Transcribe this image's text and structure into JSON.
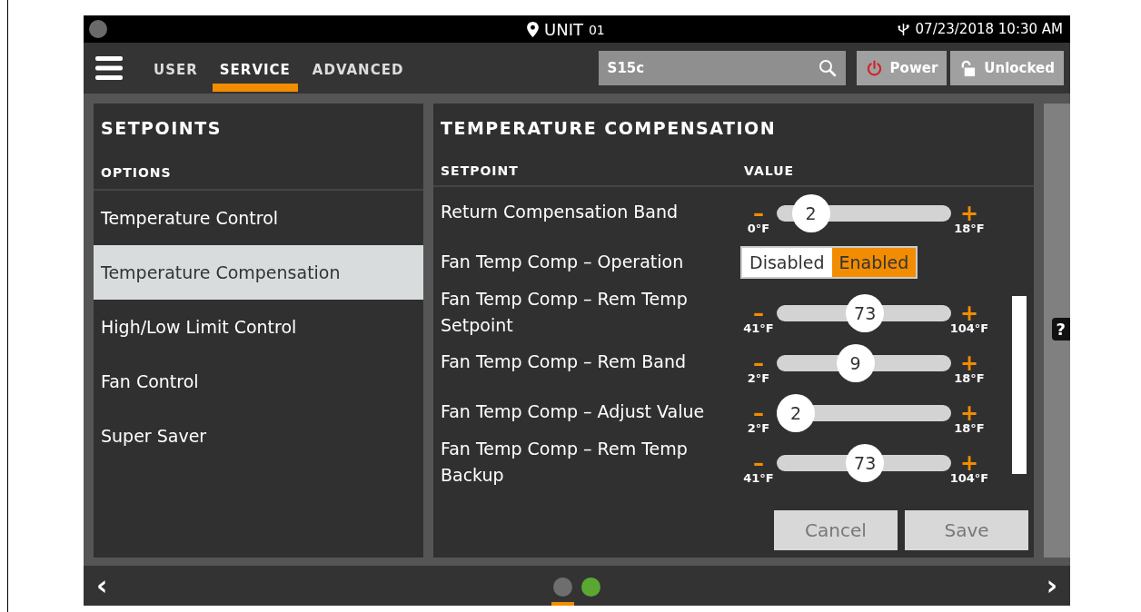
{
  "status_bar": {
    "location": "UNIT",
    "unit_number": "01",
    "datetime": "07/23/2018 10:30 AM"
  },
  "tabs": [
    {
      "label": "USER",
      "selected": false
    },
    {
      "label": "SERVICE",
      "selected": true
    },
    {
      "label": "ADVANCED",
      "selected": false
    }
  ],
  "search": {
    "value": "S15c"
  },
  "buttons": {
    "power": "Power",
    "lock": "Unlocked"
  },
  "sidebar": {
    "title": "SETPOINTS",
    "heading": "OPTIONS",
    "items": [
      {
        "label": "Temperature Control",
        "selected": false
      },
      {
        "label": "Temperature Compensation",
        "selected": true
      },
      {
        "label": "High/Low Limit Control",
        "selected": false
      },
      {
        "label": "Fan Control",
        "selected": false
      },
      {
        "label": "Super Saver",
        "selected": false
      }
    ]
  },
  "panel": {
    "title": "TEMPERATURE COMPENSATION",
    "columns": [
      "SETPOINT",
      "VALUE"
    ],
    "rows": [
      {
        "kind": "slider",
        "label": "Return Compensation Band",
        "value": "2",
        "min": "0°F",
        "max": "18°F",
        "level": 0.111
      },
      {
        "kind": "toggle",
        "label": "Fan Temp Comp – Operation",
        "options": [
          {
            "label": "Disabled",
            "selected": false
          },
          {
            "label": "Enabled",
            "selected": true
          }
        ]
      },
      {
        "kind": "slider",
        "label": "Fan Temp Comp – Rem Temp Setpoint",
        "value": "73",
        "min": "41°F",
        "max": "104°F",
        "level": 0.508
      },
      {
        "kind": "slider",
        "label": "Fan Temp Comp – Rem Band",
        "value": "9",
        "min": "2°F",
        "max": "18°F",
        "level": 0.4375
      },
      {
        "kind": "slider",
        "label": "Fan Temp Comp – Adjust Value",
        "value": "2",
        "min": "2°F",
        "max": "18°F",
        "level": 0
      },
      {
        "kind": "slider",
        "label": "Fan Temp Comp – Rem Temp Backup",
        "value": "73",
        "min": "41°F",
        "max": "104°F",
        "level": 0.508
      }
    ],
    "minus": "–",
    "plus": "+",
    "actions": [
      "Cancel",
      "Save"
    ]
  },
  "help": "?",
  "footer": {
    "prev": "‹",
    "next": "›",
    "pages": [
      {
        "selected": true,
        "color": "#6e6e6e"
      },
      {
        "selected": false,
        "color": "#5aa832"
      }
    ]
  }
}
